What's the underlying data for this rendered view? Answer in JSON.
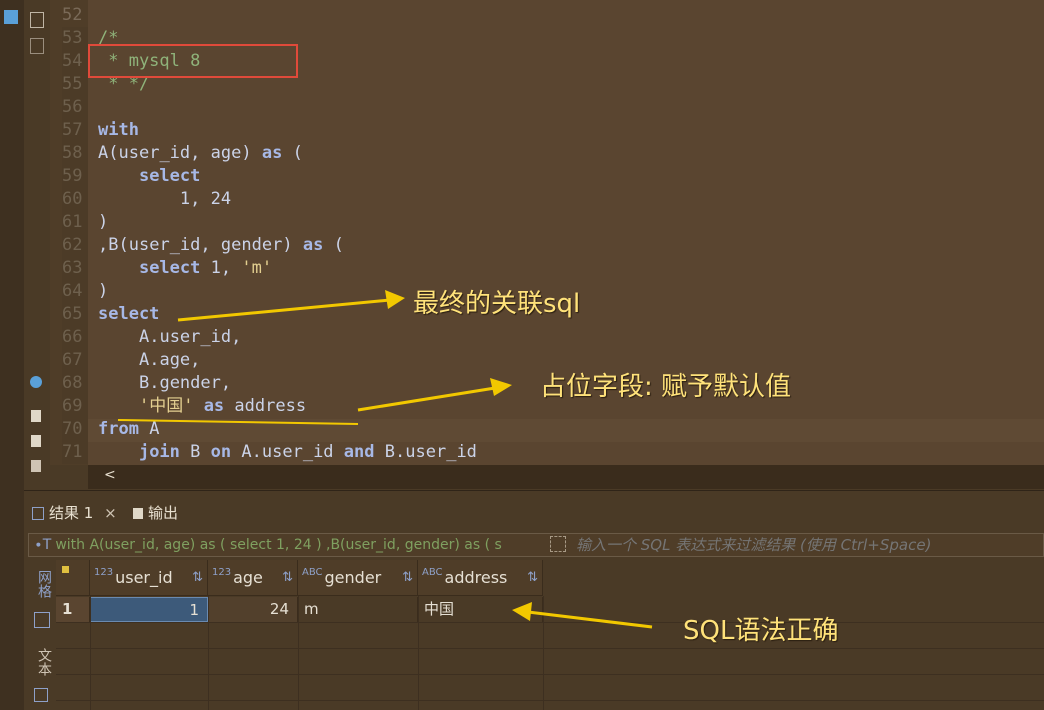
{
  "editor": {
    "lines": [
      {
        "num": "52",
        "text": ""
      },
      {
        "num": "53",
        "text": "/*"
      },
      {
        "num": "54",
        "text": " * mysql 8"
      },
      {
        "num": "55",
        "text": " * */"
      },
      {
        "num": "56",
        "text": ""
      },
      {
        "num": "57",
        "text": "with"
      },
      {
        "num": "58",
        "text": "A(user_id, age) as ("
      },
      {
        "num": "59",
        "text": "    select"
      },
      {
        "num": "60",
        "text": "        1, 24"
      },
      {
        "num": "61",
        "text": ")"
      },
      {
        "num": "62",
        "text": ",B(user_id, gender) as ("
      },
      {
        "num": "63",
        "text": "    select 1, 'm'"
      },
      {
        "num": "64",
        "text": ")"
      },
      {
        "num": "65",
        "text": "select"
      },
      {
        "num": "66",
        "text": "    A.user_id,"
      },
      {
        "num": "67",
        "text": "    A.age,"
      },
      {
        "num": "68",
        "text": "    B.gender,"
      },
      {
        "num": "69",
        "text": "    '中国' as address"
      },
      {
        "num": "70",
        "text": "from A"
      },
      {
        "num": "71",
        "text": "    join B on A.user_id and B.user_id"
      }
    ],
    "scroll_left": "<"
  },
  "result_tabs": {
    "results": "结果 1",
    "close": "×",
    "output": "输出"
  },
  "filter": {
    "query_prefix": "∙T",
    "query": "with A(user_id, age) as ( select 1, 24 ) ,B(user_id, gender) as ( s",
    "placeholder": "输入一个 SQL 表达式来过滤结果 (使用 Ctrl+Space)"
  },
  "side_tabs": {
    "grid": "网格",
    "text": "文本"
  },
  "grid": {
    "columns": [
      {
        "type": "123",
        "name": "user_id"
      },
      {
        "type": "123",
        "name": "age"
      },
      {
        "type": "ABC",
        "name": "gender"
      },
      {
        "type": "ABC",
        "name": "address"
      }
    ],
    "rows": [
      {
        "num": "1",
        "user_id": "1",
        "age": "24",
        "gender": "m",
        "address": "中国"
      }
    ]
  },
  "annotations": {
    "final_join": "最终的关联sql",
    "placeholder_field": "占位字段: 赋予默认值",
    "correct": "SQL语法正确"
  },
  "colors": {
    "annotation": "#ffe27a",
    "redbox": "#e04a3a",
    "keyword": "#a7b8e6",
    "comment": "#8fb37a"
  }
}
